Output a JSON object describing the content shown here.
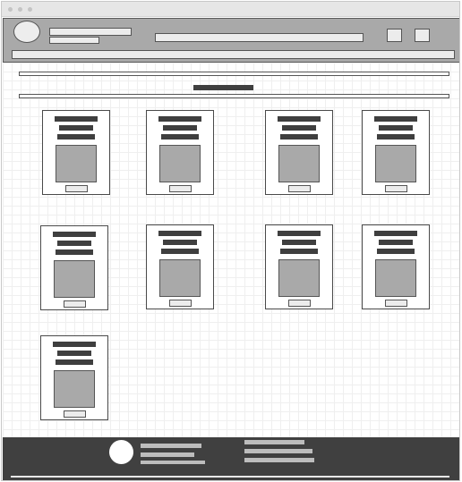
{
  "page": {
    "kind": "wireframe-mockup",
    "theme": {
      "chrome_bg": "#e6e6e6",
      "header_bg": "#a9a9a9",
      "placeholder_fill": "#a9a9a9",
      "dark_text_block": "#3f3f3f",
      "footer_bg": "#404040",
      "footer_placeholder": "#bdbdbd",
      "grid_line": "#efefef"
    }
  },
  "icons": {
    "window_dots": [
      "window-dot",
      "window-dot",
      "window-dot"
    ],
    "avatar": "avatar-circle",
    "header_buttons": [
      "square-button",
      "square-button"
    ],
    "footer_logo": "logo-circle"
  },
  "product_grid": {
    "card_count": 9,
    "card_elements": [
      "title-line",
      "subtitle-line",
      "subtitle-line",
      "image-placeholder",
      "action-button"
    ]
  }
}
